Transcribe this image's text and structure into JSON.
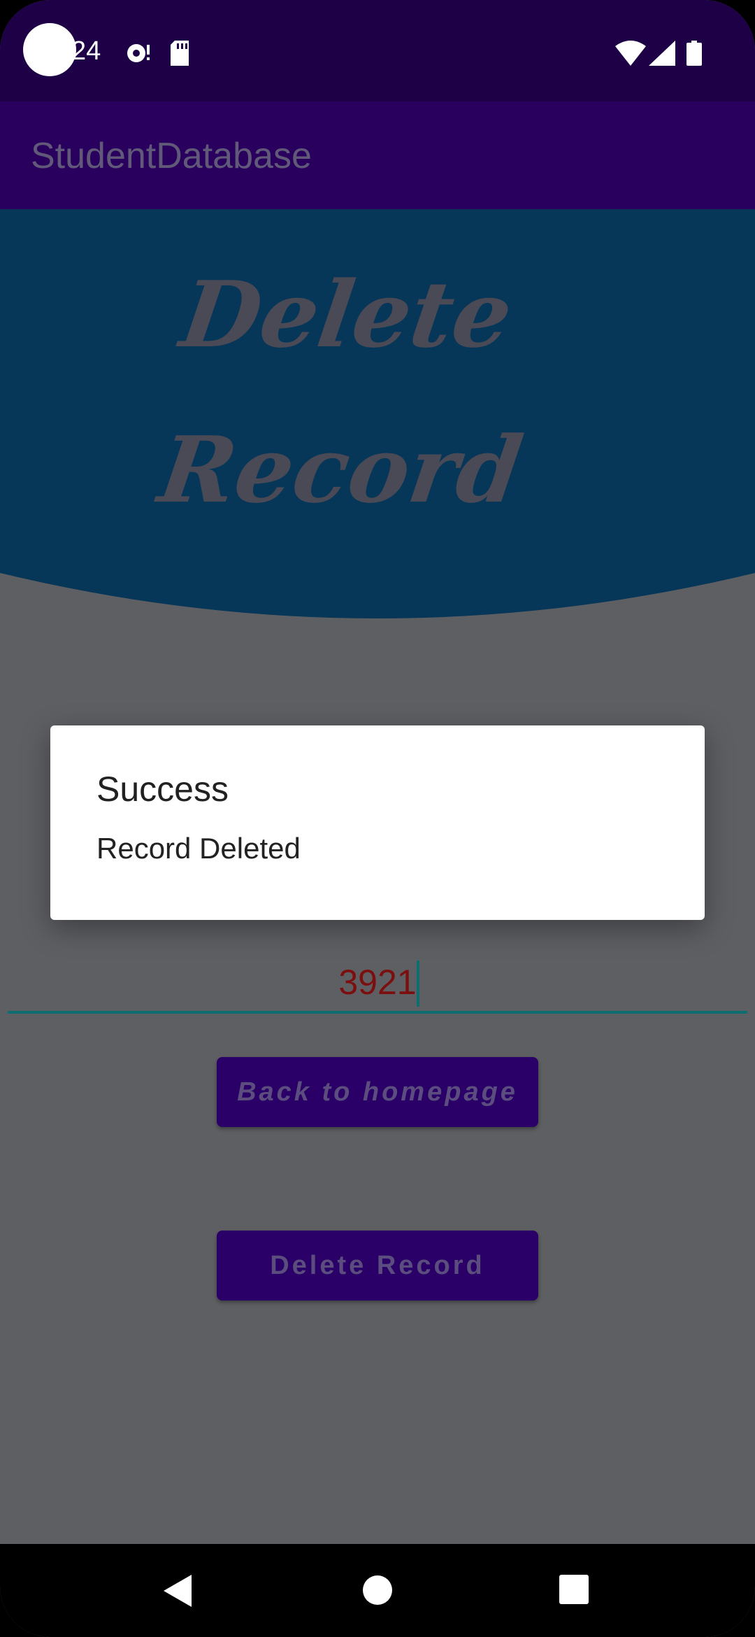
{
  "status_bar": {
    "time": "24",
    "icons": [
      "camera-dot",
      "hotspot-icon",
      "sd-card-icon",
      "wifi-icon",
      "signal-icon",
      "battery-icon"
    ]
  },
  "app_bar": {
    "title": "StudentDatabase"
  },
  "banner": {
    "line1": "Delete",
    "line2": "Record"
  },
  "input": {
    "value": "3921"
  },
  "buttons": {
    "back": "Back to homepage",
    "delete": "Delete Record"
  },
  "dialog": {
    "title": "Success",
    "message": "Record Deleted"
  },
  "nav_bar": {
    "icons": [
      "back-icon",
      "home-icon",
      "recents-icon"
    ]
  },
  "colors": {
    "status_bar": "#1d0045",
    "app_bar": "#2a005f",
    "banner": "#063658",
    "button": "#2a0068",
    "scrim_background": "#5e5f63",
    "input_underline": "#0c6e6e",
    "input_text": "#7b0f0f"
  }
}
